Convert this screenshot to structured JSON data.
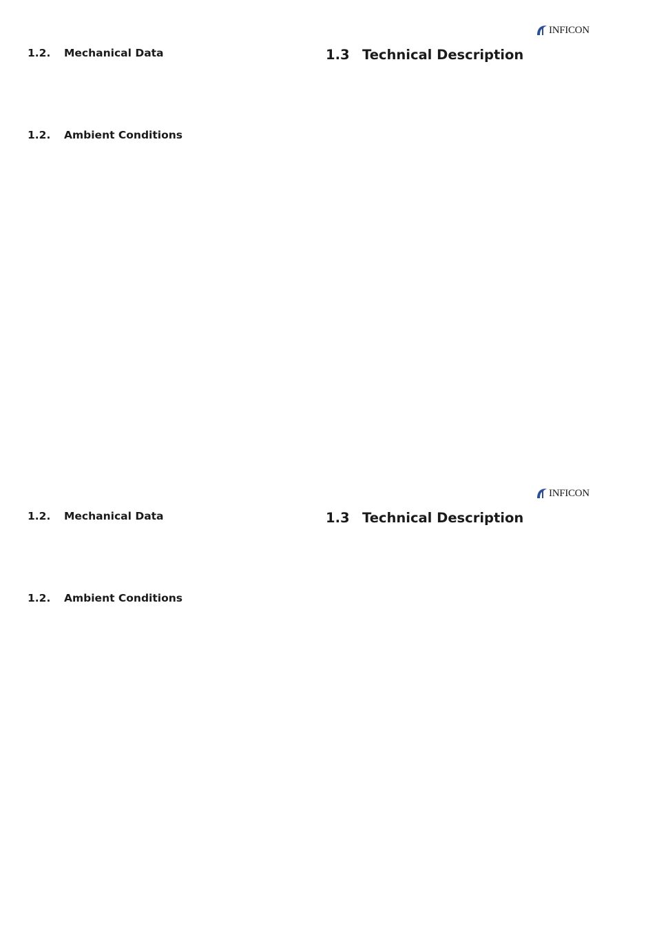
{
  "brand": {
    "logo_text": "INFICON",
    "logo_icon": "inficon-swoosh-icon",
    "logo_color": "#2b4f96"
  },
  "pages": [
    {
      "left_column": {
        "sections": [
          {
            "number": "1.2.",
            "title": "Mechanical Data"
          },
          {
            "number": "1.2.",
            "title": "Ambient Conditions"
          }
        ]
      },
      "right_column": {
        "heading": {
          "number": "1.3",
          "title": "Technical Description"
        }
      }
    },
    {
      "left_column": {
        "sections": [
          {
            "number": "1.2.",
            "title": "Mechanical Data"
          },
          {
            "number": "1.2.",
            "title": "Ambient Conditions"
          }
        ]
      },
      "right_column": {
        "heading": {
          "number": "1.3",
          "title": "Technical Description"
        }
      }
    }
  ]
}
